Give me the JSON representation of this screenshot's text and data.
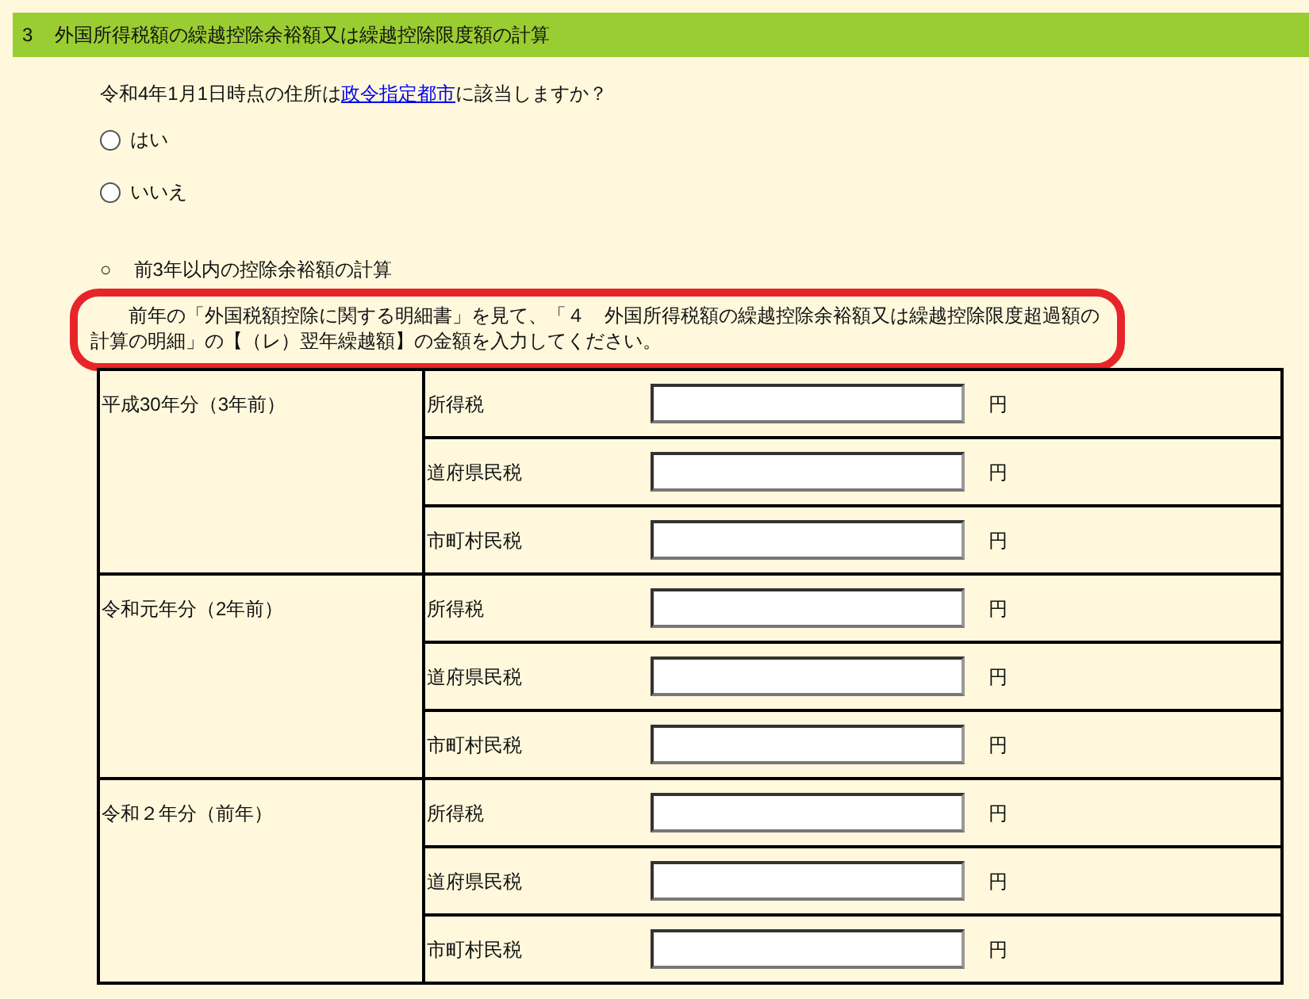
{
  "section_header": {
    "number": "3",
    "title": "外国所得税額の繰越控除余裕額又は繰越控除限度額の計算"
  },
  "question": {
    "before": "令和4年1月1日時点の住所は",
    "link": "政令指定都市",
    "after": "に該当しますか？"
  },
  "options": [
    {
      "label": "はい",
      "selected": false
    },
    {
      "label": "いいえ",
      "selected": false
    }
  ],
  "subsection": {
    "bullet": "○",
    "title": "前3年以内の控除余裕額の計算"
  },
  "instruction": "前年の「外国税額控除に関する明細書」を見て、「４　外国所得税額の繰越控除余裕額又は繰越控除限度超過額の計算の明細」の【（レ）翌年繰越額】の金額を入力してください。",
  "table": {
    "groups": [
      {
        "year": "平成30年分（3年前）",
        "rows": [
          {
            "tax": "所得税",
            "value": "",
            "unit": "円"
          },
          {
            "tax": "道府県民税",
            "value": "",
            "unit": "円"
          },
          {
            "tax": "市町村民税",
            "value": "",
            "unit": "円"
          }
        ]
      },
      {
        "year": "令和元年分（2年前）",
        "rows": [
          {
            "tax": "所得税",
            "value": "",
            "unit": "円"
          },
          {
            "tax": "道府県民税",
            "value": "",
            "unit": "円"
          },
          {
            "tax": "市町村民税",
            "value": "",
            "unit": "円"
          }
        ]
      },
      {
        "year": "令和２年分（前年）",
        "rows": [
          {
            "tax": "所得税",
            "value": "",
            "unit": "円"
          },
          {
            "tax": "道府県民税",
            "value": "",
            "unit": "円"
          },
          {
            "tax": "市町村民税",
            "value": "",
            "unit": "円"
          }
        ]
      }
    ]
  }
}
